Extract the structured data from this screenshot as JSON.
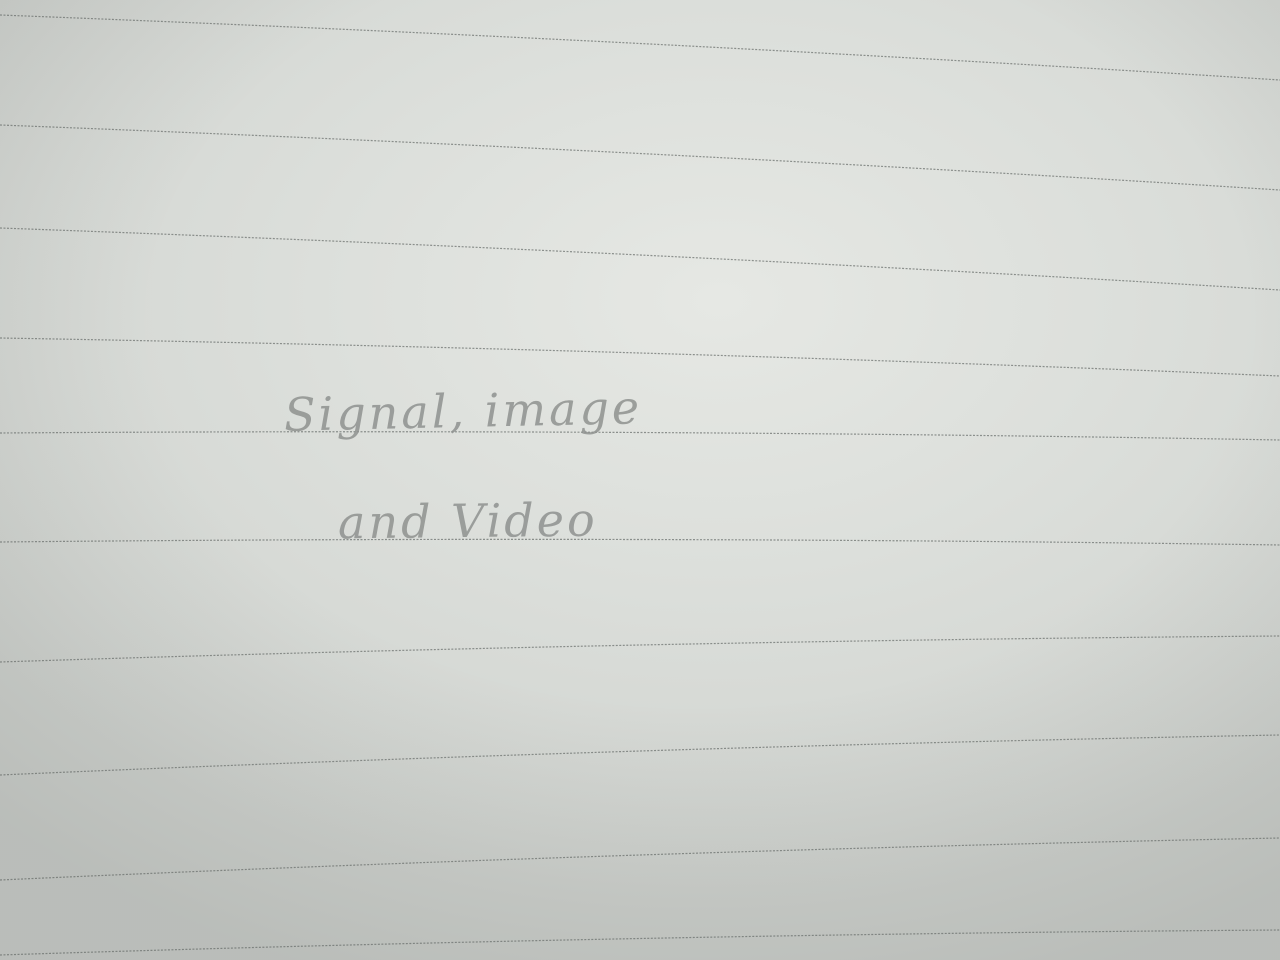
{
  "notebook": {
    "handwritten_text": {
      "line1": "Signal, image",
      "line2": "and Video"
    },
    "colors": {
      "paper": "#e2e4e0",
      "rule_line": "#6e7370",
      "pencil": "#8f9290"
    }
  }
}
